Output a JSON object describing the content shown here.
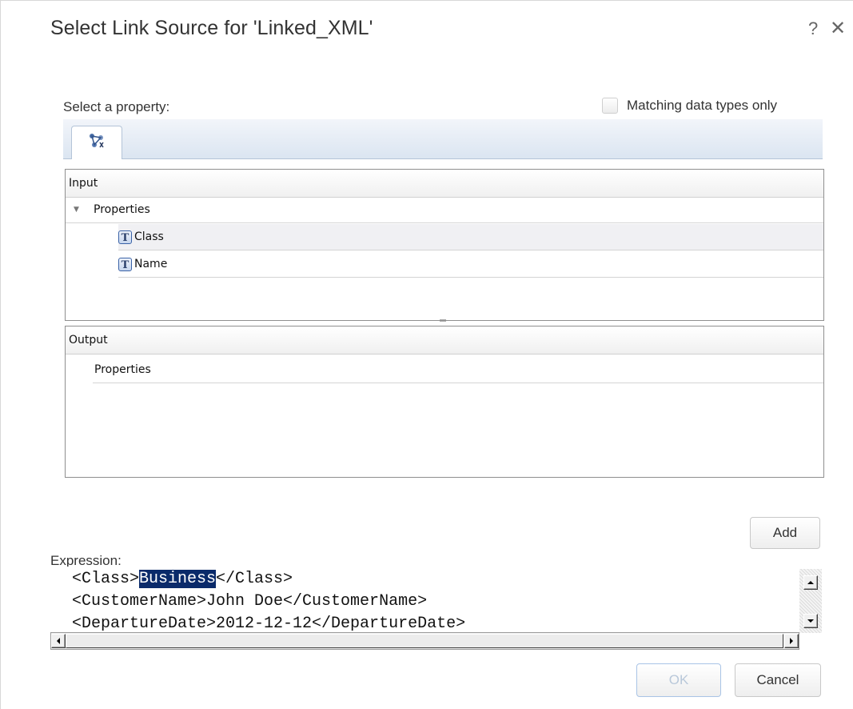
{
  "dialog": {
    "title": "Select Link Source for 'Linked_XML'",
    "help_label": "?",
    "close_label": "✕"
  },
  "property_section": {
    "label": "Select a property:",
    "matching_checkbox_label": "Matching data types only",
    "matching_checked": false,
    "tab_icon": "properties-tab-icon"
  },
  "input_panel": {
    "header": "Input",
    "group_label": "Properties",
    "items": [
      "Class",
      "Name"
    ],
    "item_type_icon": "T",
    "selected_item": "Class"
  },
  "output_panel": {
    "header": "Output",
    "group_label": "Properties"
  },
  "expression": {
    "label": "Expression:",
    "line1_open": "<Class>",
    "line1_value": "Business",
    "line1_close": "</Class>",
    "line2": "<CustomerName>John Doe</CustomerName>",
    "line3": "<DepartureDate>2012-12-12</DepartureDate>"
  },
  "buttons": {
    "add_label": "Add",
    "ok_label": "OK",
    "cancel_label": "Cancel"
  },
  "colors": {
    "selection_highlight": "#0a2a6a",
    "tab_strip": "#dbe5f1"
  }
}
